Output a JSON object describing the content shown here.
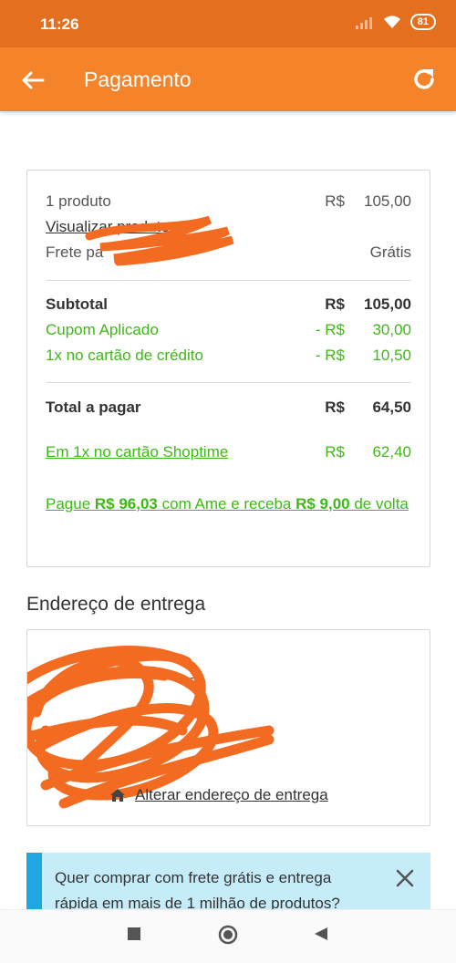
{
  "status": {
    "time": "11:26",
    "battery": "81"
  },
  "app_bar": {
    "title": "Pagamento"
  },
  "summary": {
    "products_label": "1 produto",
    "products_currency": "R$",
    "products_value": "105,00",
    "view_products": "Visualizar produtos",
    "shipping_label": "Frete pa",
    "shipping_value": "Grátis",
    "subtotal_label": "Subtotal",
    "subtotal_currency": "R$",
    "subtotal_value": "105,00",
    "coupon_label": "Cupom Aplicado",
    "coupon_currency": "- R$",
    "coupon_value": "30,00",
    "credit_label": "1x no cartão de crédito",
    "credit_currency": "- R$",
    "credit_value": "10,50",
    "total_label": "Total a pagar",
    "total_currency": "R$",
    "total_value": "64,50",
    "shoptime_label": "Em 1x no cartão Shoptime",
    "shoptime_currency": "R$",
    "shoptime_value": "62,40",
    "ame_pre": "Pague ",
    "ame_amount": "R$ 96,03",
    "ame_mid": " com Ame e receba ",
    "ame_cashback": "R$ 9,00",
    "ame_post": " de volta"
  },
  "address": {
    "section_title": "Endereço de entrega",
    "partial_line": "70",
    "change_label": "Alterar endereço de entrega"
  },
  "banner": {
    "text": "Quer comprar com frete grátis e entrega rápida em mais de 1 milhão de produtos?"
  },
  "colors": {
    "status_bar": "#e36f1f",
    "app_bar": "#f5832a",
    "green": "#3fb818",
    "banner_bg": "#c6ecfa",
    "banner_accent": "#20a7e2",
    "scribble": "#f36a21"
  },
  "icons": {
    "back": "arrow-left-icon",
    "refresh": "refresh-icon",
    "home": "home-icon",
    "close": "close-icon",
    "nav_square": "square-icon",
    "nav_circle": "circle-icon",
    "nav_back": "triangle-icon"
  }
}
